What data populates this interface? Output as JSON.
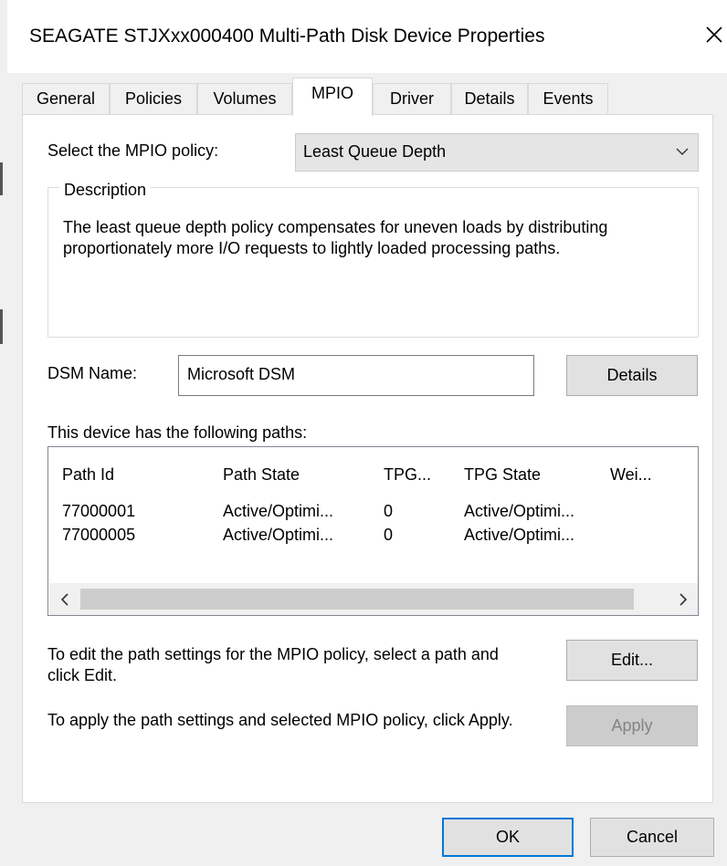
{
  "window": {
    "title": "SEAGATE STJXxx000400  Multi-Path Disk Device Properties"
  },
  "tabs": [
    {
      "label": "General"
    },
    {
      "label": "Policies"
    },
    {
      "label": "Volumes"
    },
    {
      "label": "MPIO",
      "active": true
    },
    {
      "label": "Driver"
    },
    {
      "label": "Details"
    },
    {
      "label": "Events"
    }
  ],
  "policy": {
    "label": "Select the MPIO policy:",
    "selected": "Least Queue Depth"
  },
  "description": {
    "legend": "Description",
    "text": "The least queue depth policy compensates for uneven loads by distributing proportionately more I/O requests to lightly loaded processing paths."
  },
  "dsm": {
    "label": "DSM Name:",
    "value": "Microsoft DSM",
    "details_label": "Details"
  },
  "paths": {
    "label": "This device has the following paths:",
    "columns": [
      "Path Id",
      "Path State",
      "TPG...",
      "TPG State",
      "Wei..."
    ],
    "rows": [
      [
        "77000001",
        "Active/Optimi...",
        "0",
        "Active/Optimi...",
        ""
      ],
      [
        "77000005",
        "Active/Optimi...",
        "0",
        "Active/Optimi...",
        ""
      ]
    ]
  },
  "edit": {
    "text": "To edit the path settings for the MPIO policy, select a path and click Edit.",
    "button": "Edit..."
  },
  "apply": {
    "text": "To apply the path settings and selected MPIO policy, click Apply.",
    "button": "Apply"
  },
  "footer": {
    "ok": "OK",
    "cancel": "Cancel"
  },
  "colors": {
    "accent": "#0078d7",
    "window_bg": "#f0f0f0",
    "panel_bg": "#ffffff",
    "disabled_text": "#838383"
  }
}
